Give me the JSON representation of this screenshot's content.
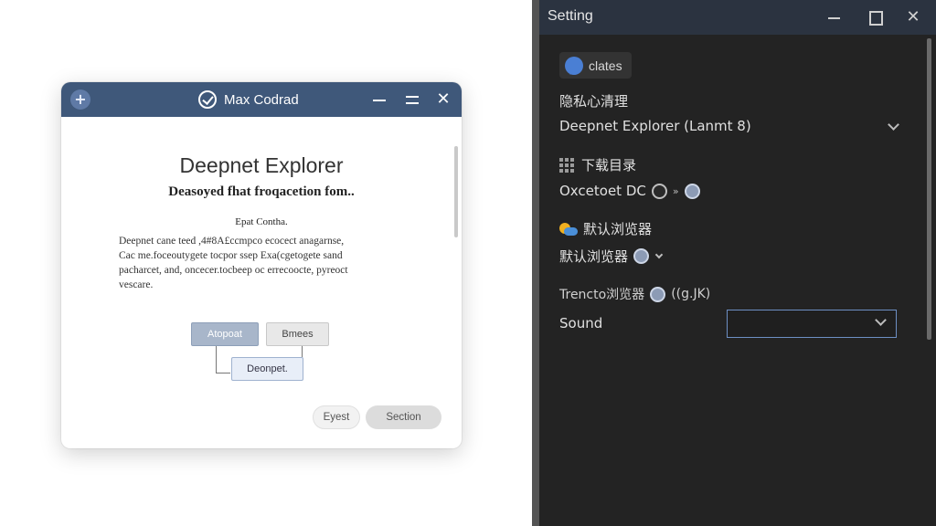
{
  "dialog": {
    "title": "Max Codrad",
    "heading": "Deepnet Explorer",
    "subheading": "Deasoyed fhat froqacetion fom..",
    "section_label": "Epat Contha.",
    "body_lines": [
      "Deepnet cane teed ,4#8A£ccmpco ecocect anagarnse,",
      "Cac me.foceoutygete tocpor ssep Exa(cgetogete sand",
      "pacharcet, and, oncecer.tocbeep oc errecoocte, pyreoct",
      "vescare."
    ],
    "buttons": {
      "accept": "Atopoat",
      "browse": "Bmees",
      "default": "Deonpet.",
      "eyest": "Eyest",
      "section": "Section"
    }
  },
  "settings": {
    "title": "Setting",
    "chip_label": "clates",
    "privacy_heading": "隐私心清理",
    "browser_value": "Deepnet Explorer (Lanmt 8)",
    "download_heading": "下载目录",
    "download_value": "Oxcetoet DC",
    "download_arrows": "»",
    "default_heading": "默认浏览器",
    "default_value": "默认浏览器",
    "trend_label": "Trencto浏览器",
    "trend_value": "((g.JK)",
    "sound_label": "Sound",
    "sound_value": ""
  },
  "colors": {
    "dialog_titlebar": "#3f587a",
    "settings_bg": "#232323",
    "settings_titlebar": "#2b3340",
    "accent_blue": "#4a7fd4"
  }
}
